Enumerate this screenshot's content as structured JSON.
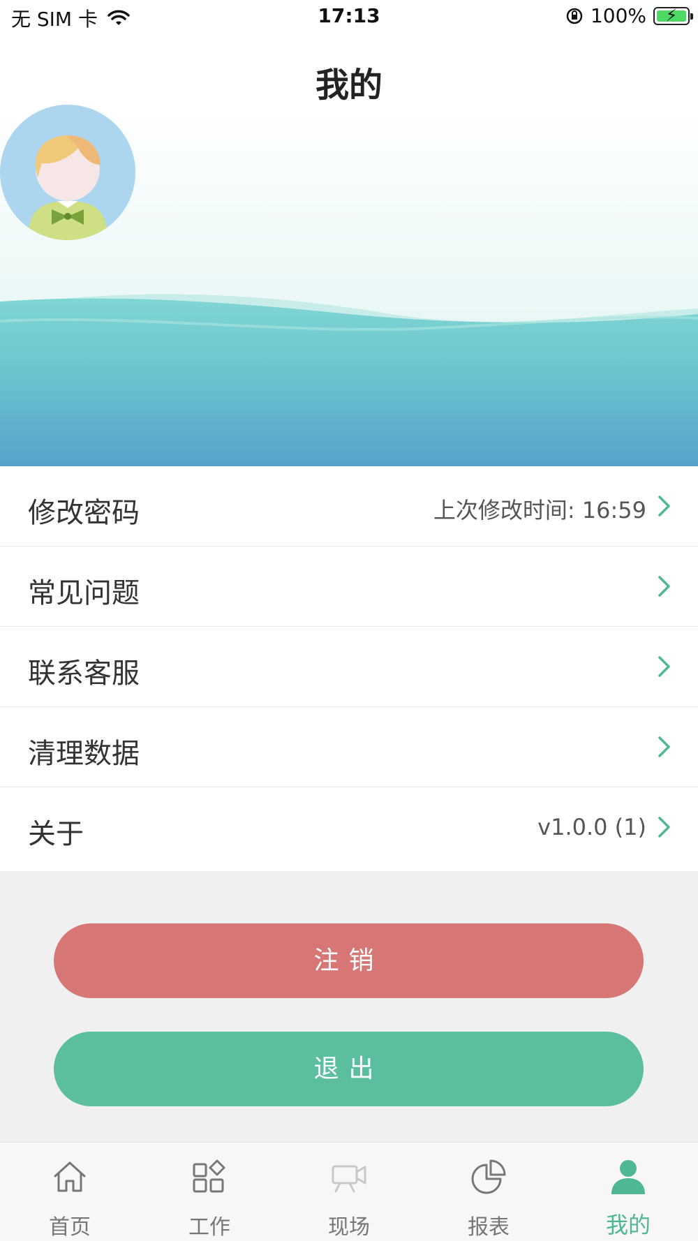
{
  "status_bar": {
    "carrier": "无 SIM 卡",
    "time": "17:13",
    "battery": "100%"
  },
  "page_title": "我的",
  "menu": [
    {
      "label": "修改密码",
      "value": "上次修改时间: 16:59"
    },
    {
      "label": "常见问题",
      "value": ""
    },
    {
      "label": "联系客服",
      "value": ""
    },
    {
      "label": "清理数据",
      "value": ""
    },
    {
      "label": "关于",
      "value": "v1.0.0 (1)"
    }
  ],
  "buttons": {
    "logout": "注销",
    "exit": "退出"
  },
  "tabbar": [
    {
      "label": "首页",
      "icon": "home-icon"
    },
    {
      "label": "工作",
      "icon": "apps-icon"
    },
    {
      "label": "现场",
      "icon": "camera-icon"
    },
    {
      "label": "报表",
      "icon": "pie-chart-icon"
    },
    {
      "label": "我的",
      "icon": "user-icon"
    }
  ],
  "colors": {
    "accent": "#4fb892",
    "logout_button": "#d67775",
    "exit_button": "#5bbf9f"
  }
}
